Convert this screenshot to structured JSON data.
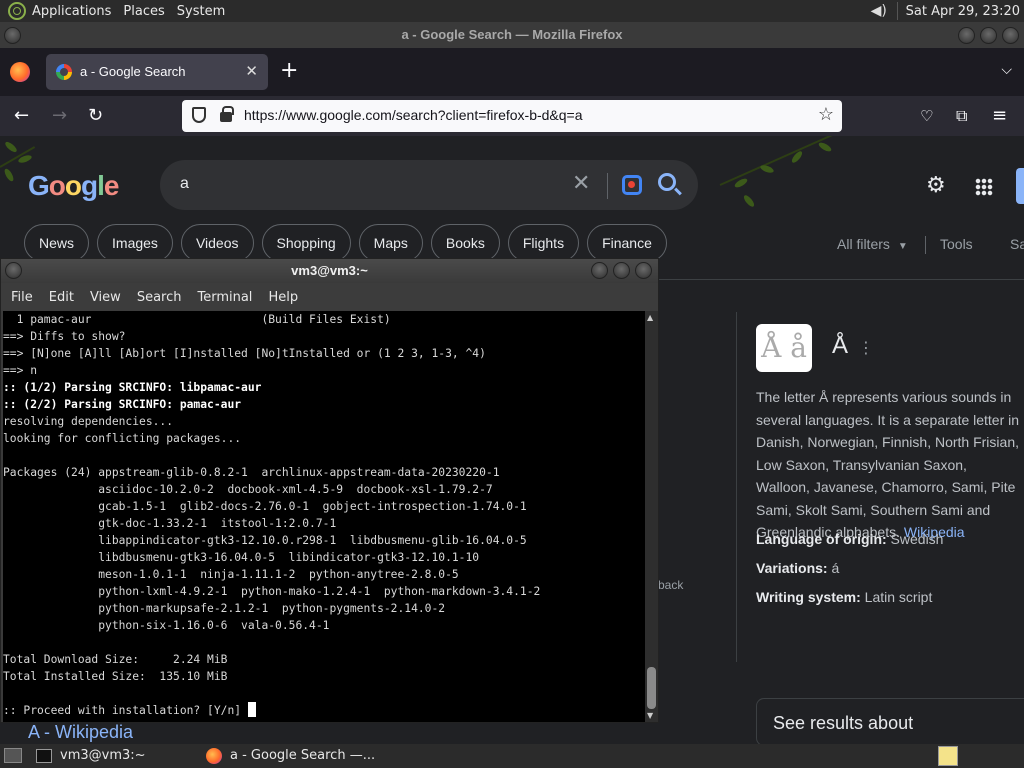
{
  "top_panel": {
    "menus": [
      "Applications",
      "Places",
      "System"
    ],
    "clock": "Sat Apr 29, 23:20"
  },
  "firefox": {
    "window_title": "a - Google Search — Mozilla Firefox",
    "tab_title": "a - Google Search",
    "url": "https://www.google.com/search?client=firefox-b-d&q=a"
  },
  "google": {
    "query": "a",
    "chips": [
      "News",
      "Images",
      "Videos",
      "Shopping",
      "Maps",
      "Books",
      "Flights",
      "Finance"
    ],
    "all_filters": "All filters",
    "tools": "Tools",
    "safesearch_partial": "Sa",
    "feedback_partial": "back",
    "result_title": "A - Wikipedia",
    "knowledge_panel": {
      "title": "Å",
      "thumb_text": "Å å",
      "description": "The letter Å represents various sounds in several languages. It is a separate letter in Danish, Norwegian, Finnish, North Frisian, Low Saxon, Transylvanian Saxon, Walloon, Javanese, Chamorro, Sami, Pite Sami, Skolt Sami, Southern Sami and Greenlandic alphabets.",
      "wiki_link": "Wikipedia",
      "facts": [
        {
          "label": "Language of origin:",
          "value": "Swedish"
        },
        {
          "label": "Variations:",
          "value": "á"
        },
        {
          "label": "Writing system:",
          "value": "Latin script"
        }
      ],
      "see_results": "See results about"
    }
  },
  "terminal": {
    "title": "vm3@vm3:~",
    "menus": [
      "File",
      "Edit",
      "View",
      "Search",
      "Terminal",
      "Help"
    ],
    "lines": [
      {
        "text": "  1 pamac-aur                         (Build Files Exist)",
        "bold": false
      },
      {
        "text": "==> Diffs to show?",
        "bold": false
      },
      {
        "text": "==> [N]one [A]ll [Ab]ort [I]nstalled [No]tInstalled or (1 2 3, 1-3, ^4)",
        "bold": false
      },
      {
        "text": "==> n",
        "bold": false
      },
      {
        "text": ":: (1/2) Parsing SRCINFO: libpamac-aur",
        "bold": true
      },
      {
        "text": ":: (2/2) Parsing SRCINFO: pamac-aur",
        "bold": true
      },
      {
        "text": "resolving dependencies...",
        "bold": false
      },
      {
        "text": "looking for conflicting packages...",
        "bold": false
      },
      {
        "text": "",
        "bold": false
      },
      {
        "text": "Packages (24) appstream-glib-0.8.2-1  archlinux-appstream-data-20230220-1",
        "bold": false
      },
      {
        "text": "              asciidoc-10.2.0-2  docbook-xml-4.5-9  docbook-xsl-1.79.2-7",
        "bold": false
      },
      {
        "text": "              gcab-1.5-1  glib2-docs-2.76.0-1  gobject-introspection-1.74.0-1",
        "bold": false
      },
      {
        "text": "              gtk-doc-1.33.2-1  itstool-1:2.0.7-1",
        "bold": false
      },
      {
        "text": "              libappindicator-gtk3-12.10.0.r298-1  libdbusmenu-glib-16.04.0-5",
        "bold": false
      },
      {
        "text": "              libdbusmenu-gtk3-16.04.0-5  libindicator-gtk3-12.10.1-10",
        "bold": false
      },
      {
        "text": "              meson-1.0.1-1  ninja-1.11.1-2  python-anytree-2.8.0-5",
        "bold": false
      },
      {
        "text": "              python-lxml-4.9.2-1  python-mako-1.2.4-1  python-markdown-3.4.1-2",
        "bold": false
      },
      {
        "text": "              python-markupsafe-2.1.2-1  python-pygments-2.14.0-2",
        "bold": false
      },
      {
        "text": "              python-six-1.16.0-6  vala-0.56.4-1",
        "bold": false
      },
      {
        "text": "",
        "bold": false
      },
      {
        "text": "Total Download Size:     2.24 MiB",
        "bold": false
      },
      {
        "text": "Total Installed Size:  135.10 MiB",
        "bold": false
      },
      {
        "text": "",
        "bold": false
      }
    ],
    "prompt": ":: Proceed with installation? [Y/n] "
  },
  "taskbar": {
    "tasks": [
      "vm3@vm3:~",
      "a - Google Search —..."
    ]
  }
}
